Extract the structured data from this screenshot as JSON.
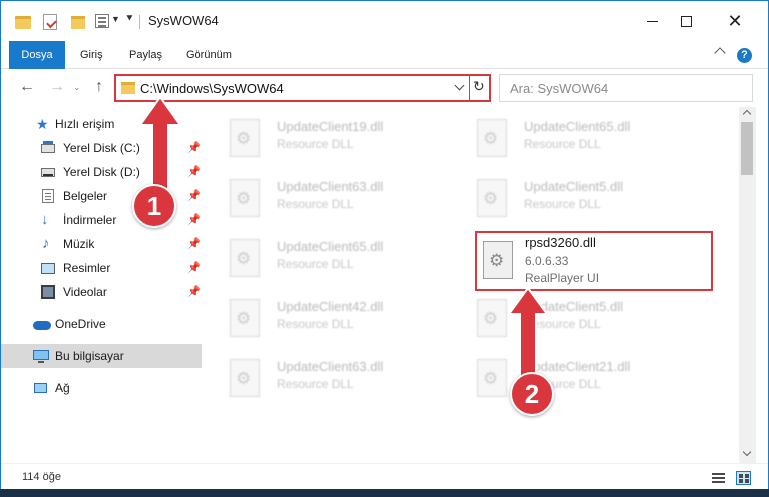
{
  "window": {
    "title": "SysWOW64",
    "minimize_label": "–",
    "maximize_label": "□",
    "close_label": "✕"
  },
  "ribbon": {
    "tabs": [
      {
        "label": "Dosya",
        "active": true
      },
      {
        "label": "Giriş"
      },
      {
        "label": "Paylaş"
      },
      {
        "label": "Görünüm"
      }
    ],
    "help_label": "?"
  },
  "address": {
    "path": "C:\\Windows\\SysWOW64",
    "search_placeholder": "Ara: SysWOW64"
  },
  "navpane": {
    "items": [
      {
        "label": "Hızlı erişim",
        "icon": "star-icon"
      },
      {
        "label": "Yerel Disk (C:)",
        "icon": "drive-icon",
        "pinned": true
      },
      {
        "label": "Yerel Disk (D:)",
        "icon": "drive-icon",
        "pinned": true
      },
      {
        "label": "Belgeler",
        "icon": "documents-icon",
        "pinned": true
      },
      {
        "label": "İndirmeler",
        "icon": "downloads-icon",
        "pinned": true
      },
      {
        "label": "Müzik",
        "icon": "music-icon",
        "pinned": true
      },
      {
        "label": "Resimler",
        "icon": "pictures-icon",
        "pinned": true
      },
      {
        "label": "Videolar",
        "icon": "videos-icon",
        "pinned": true
      },
      {
        "label": "OneDrive",
        "icon": "onedrive-icon"
      },
      {
        "label": "Bu bilgisayar",
        "icon": "this-pc-icon",
        "selected": true
      },
      {
        "label": "Ağ",
        "icon": "network-icon"
      }
    ]
  },
  "files": {
    "blurred": [
      {
        "name": "UpdateClient19.dll",
        "desc": "Resource DLL"
      },
      {
        "name": "UpdateClient65.dll",
        "desc": "Resource DLL"
      },
      {
        "name": "UpdateClient63.dll",
        "desc": "Resource DLL"
      },
      {
        "name": "UpdateClient5.dll",
        "desc": "Resource DLL"
      },
      {
        "name": "UpdateClient65.dll",
        "desc": "Resource DLL"
      },
      {
        "name": "UpdateClient42.dll",
        "desc": "Resource DLL"
      },
      {
        "name": "UpdateClient5.dll",
        "desc": "Resource DLL"
      },
      {
        "name": "UpdateClient63.dll",
        "desc": "Resource DLL"
      },
      {
        "name": "UpdateClient21.dll",
        "desc": "Resource DLL"
      }
    ],
    "highlighted": {
      "name": "rpsd3260.dll",
      "version": "6.0.6.33",
      "company": "RealPlayer UI"
    }
  },
  "status": {
    "item_count": "114 öğe"
  },
  "annotations": {
    "step1": "1",
    "step2": "2",
    "color": "#d9363e"
  }
}
